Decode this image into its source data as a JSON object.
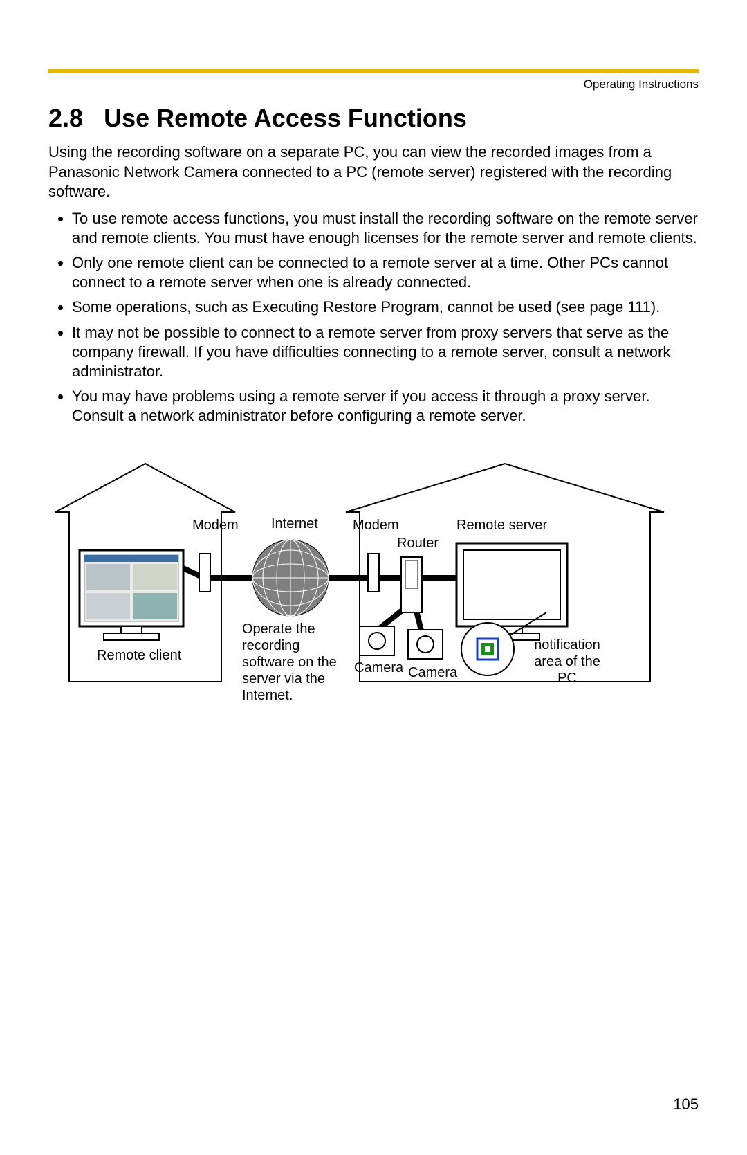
{
  "header": {
    "right": "Operating Instructions"
  },
  "section": {
    "number": "2.8",
    "title": "Use Remote Access Functions",
    "intro": "Using the recording software on a separate PC, you can view the recorded images from a Panasonic Network Camera connected to a PC (remote server) registered with the recording software.",
    "bullets": [
      "To use remote access functions, you must install the recording software on the remote server and remote clients. You must have enough licenses for the remote server and remote clients.",
      "Only one remote client can be connected to a remote server at a time. Other PCs cannot connect to a remote server when one is already connected.",
      "Some operations, such as Executing Restore Program, cannot be used (see page 111).",
      "It may not be possible to connect to a remote server from proxy servers that serve as the company firewall. If you have difficulties connecting to a remote server, consult a network administrator.",
      "You may have problems using a remote server if you access it through a proxy server. Consult a network administrator before configuring a remote server."
    ]
  },
  "diagram": {
    "labels": {
      "modem_left": "Modem",
      "internet": "Internet",
      "modem_right": "Modem",
      "remote_server": "Remote server",
      "router": "Router",
      "remote_client": "Remote client",
      "operate_note": "Operate the recording software on the server via the Internet.",
      "camera1": "Camera",
      "camera2": "Camera",
      "notification": "notification area of the PC"
    }
  },
  "page_number": "105"
}
